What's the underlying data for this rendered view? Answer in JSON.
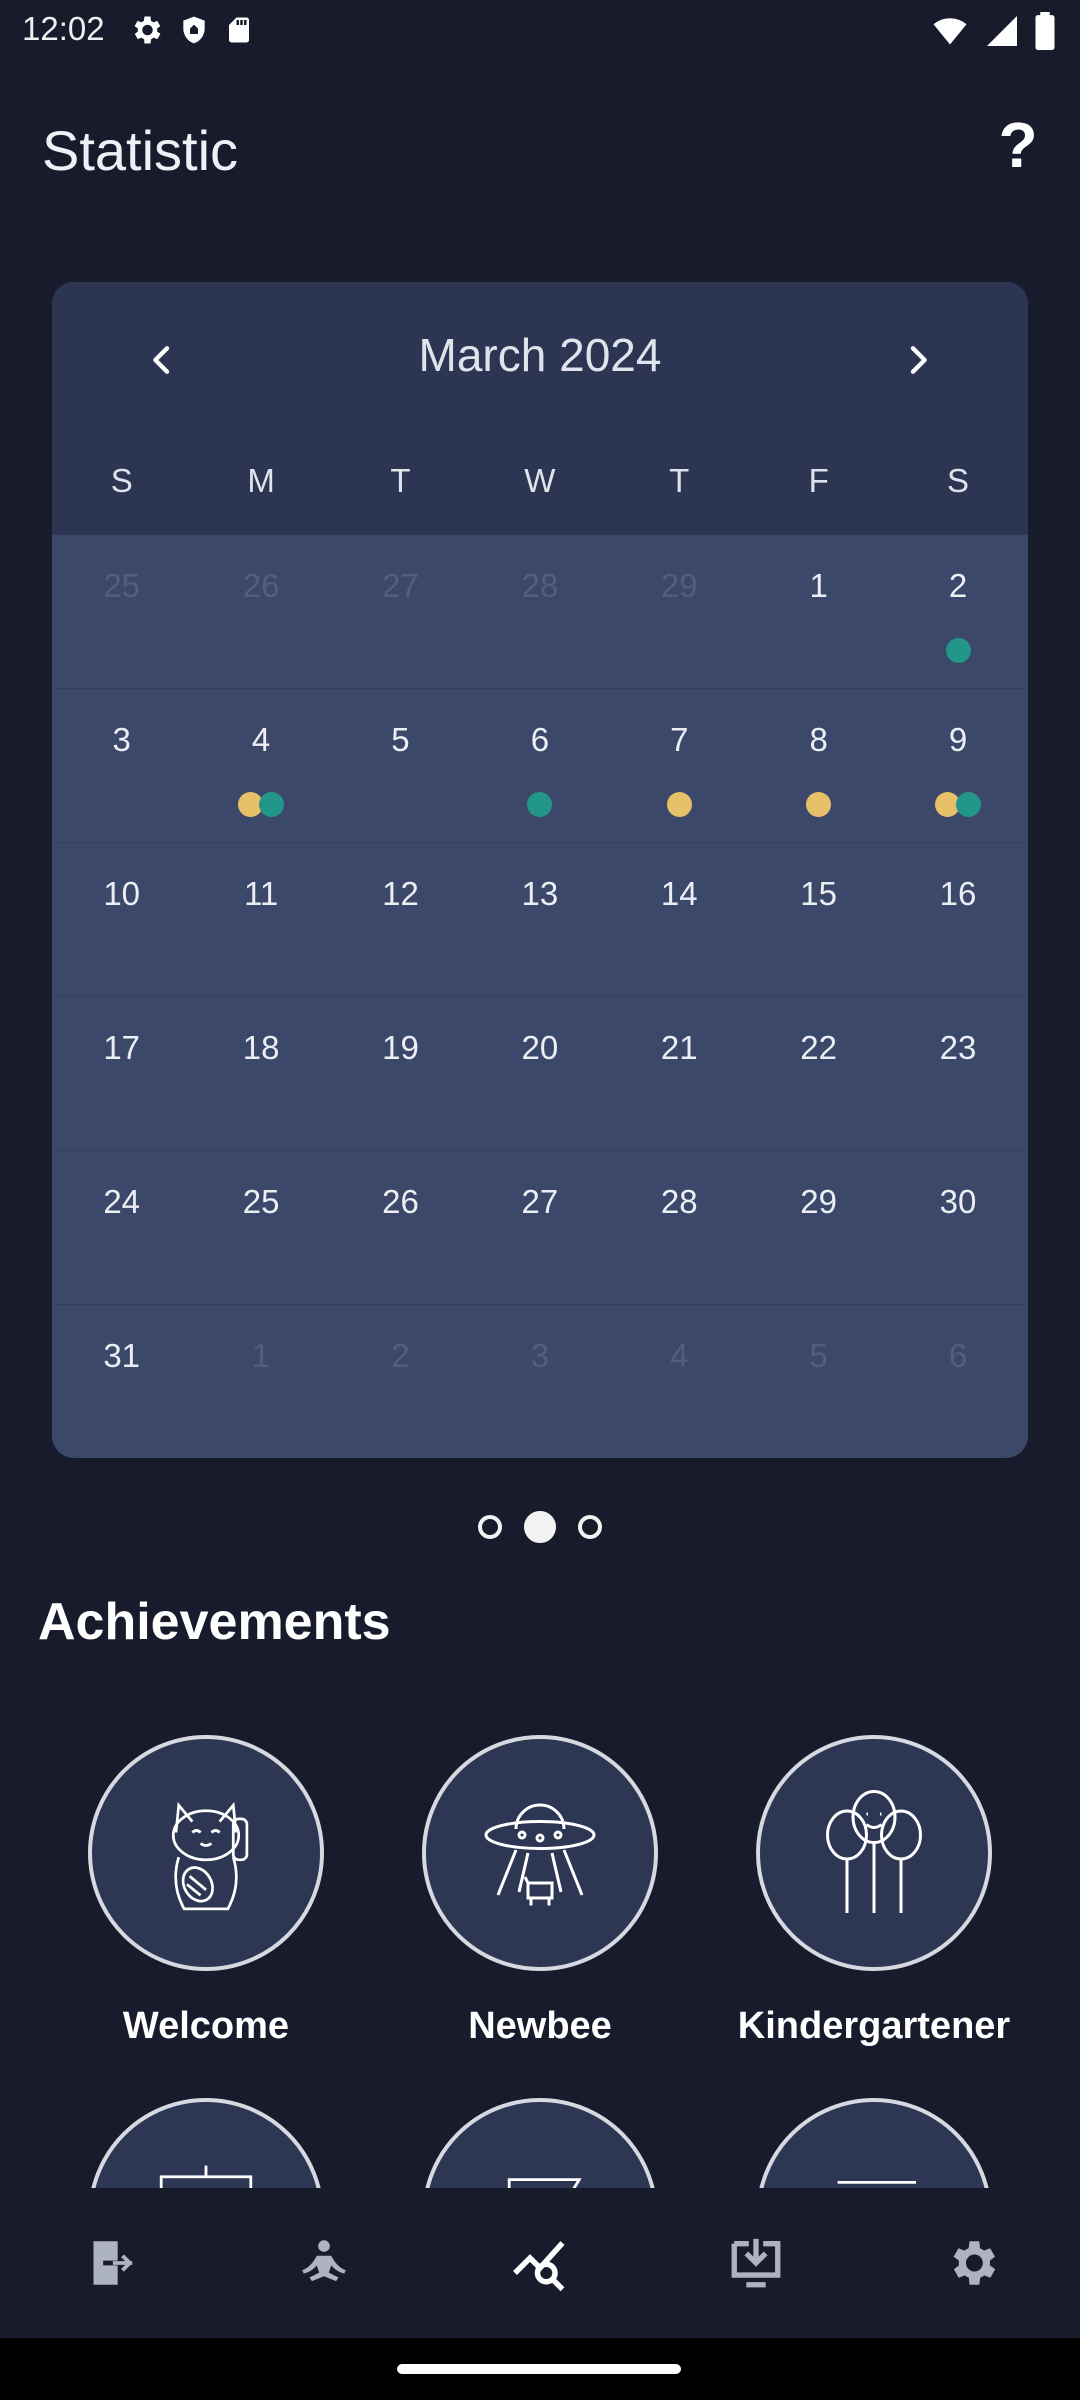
{
  "status_bar": {
    "time": "12:02"
  },
  "header": {
    "title": "Statistic",
    "help_label": "?"
  },
  "calendar": {
    "month_year": "March  2024",
    "weekdays": [
      "S",
      "M",
      "T",
      "W",
      "T",
      "F",
      "S"
    ],
    "weeks": [
      [
        {
          "n": "25",
          "m": true
        },
        {
          "n": "26",
          "m": true
        },
        {
          "n": "27",
          "m": true
        },
        {
          "n": "28",
          "m": true
        },
        {
          "n": "29",
          "m": true
        },
        {
          "n": "1"
        },
        {
          "n": "2",
          "dots": [
            "g"
          ]
        }
      ],
      [
        {
          "n": "3"
        },
        {
          "n": "4",
          "dots": [
            "y",
            "g"
          ]
        },
        {
          "n": "5"
        },
        {
          "n": "6",
          "dots": [
            "g"
          ]
        },
        {
          "n": "7",
          "dots": [
            "y"
          ]
        },
        {
          "n": "8",
          "dots": [
            "y"
          ]
        },
        {
          "n": "9",
          "dots": [
            "y",
            "g"
          ]
        }
      ],
      [
        {
          "n": "10"
        },
        {
          "n": "11"
        },
        {
          "n": "12"
        },
        {
          "n": "13"
        },
        {
          "n": "14"
        },
        {
          "n": "15"
        },
        {
          "n": "16"
        }
      ],
      [
        {
          "n": "17"
        },
        {
          "n": "18"
        },
        {
          "n": "19"
        },
        {
          "n": "20"
        },
        {
          "n": "21"
        },
        {
          "n": "22"
        },
        {
          "n": "23"
        }
      ],
      [
        {
          "n": "24"
        },
        {
          "n": "25"
        },
        {
          "n": "26"
        },
        {
          "n": "27"
        },
        {
          "n": "28"
        },
        {
          "n": "29"
        },
        {
          "n": "30"
        }
      ],
      [
        {
          "n": "31"
        },
        {
          "n": "1",
          "m": true
        },
        {
          "n": "2",
          "m": true
        },
        {
          "n": "3",
          "m": true
        },
        {
          "n": "4",
          "m": true
        },
        {
          "n": "5",
          "m": true
        },
        {
          "n": "6",
          "m": true
        }
      ]
    ],
    "dot_colors": {
      "y": "#e7c06a",
      "g": "#23968a"
    }
  },
  "pager": {
    "count": 3,
    "active": 1
  },
  "achievements": {
    "title": "Achievements",
    "items": [
      {
        "label": "Welcome",
        "icon": "lucky-cat-icon"
      },
      {
        "label": "Newbee",
        "icon": "ufo-icon"
      },
      {
        "label": "Kindergartener",
        "icon": "balloons-icon"
      }
    ]
  },
  "bottom_nav": [
    "exit-icon",
    "meditation-icon",
    "statistics-icon",
    "download-icon",
    "settings-icon"
  ]
}
